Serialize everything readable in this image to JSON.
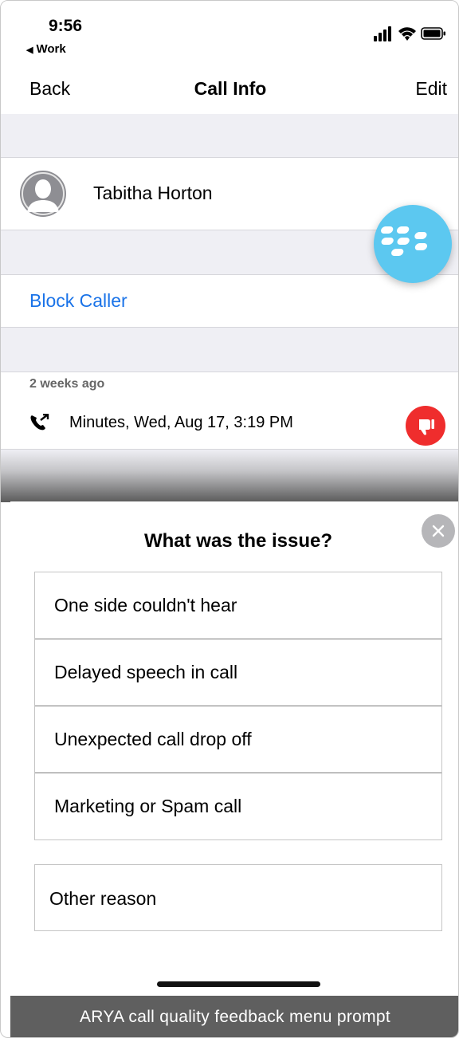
{
  "status_bar": {
    "time": "9:56",
    "back_app": "Work",
    "icons": [
      "cellular-signal-icon",
      "wifi-icon",
      "battery-icon"
    ]
  },
  "navbar": {
    "back_label": "Back",
    "title": "Call Info",
    "edit_label": "Edit"
  },
  "contact": {
    "name": "Tabitha Horton"
  },
  "blackberry_button": {
    "icon": "blackberry-logo-icon",
    "color": "#5cc8f0"
  },
  "actions": {
    "block_caller": "Block Caller",
    "link_color": "#1a73e8"
  },
  "call_history": {
    "section_label": "2 weeks ago",
    "entry": "Minutes, Wed, Aug 17, 3:19 PM",
    "call_icon": "outgoing-call-icon",
    "feedback_icon": "thumbs-down-icon",
    "feedback_color": "#ef2d2d"
  },
  "feedback_sheet": {
    "title": "What was the issue?",
    "close_icon": "close-icon",
    "options": [
      "One side couldn't hear",
      "Delayed speech in call",
      "Unexpected call drop off",
      "Marketing or Spam call"
    ],
    "other_option": "Other reason"
  },
  "caption": "ARYA call quality feedback menu prompt"
}
